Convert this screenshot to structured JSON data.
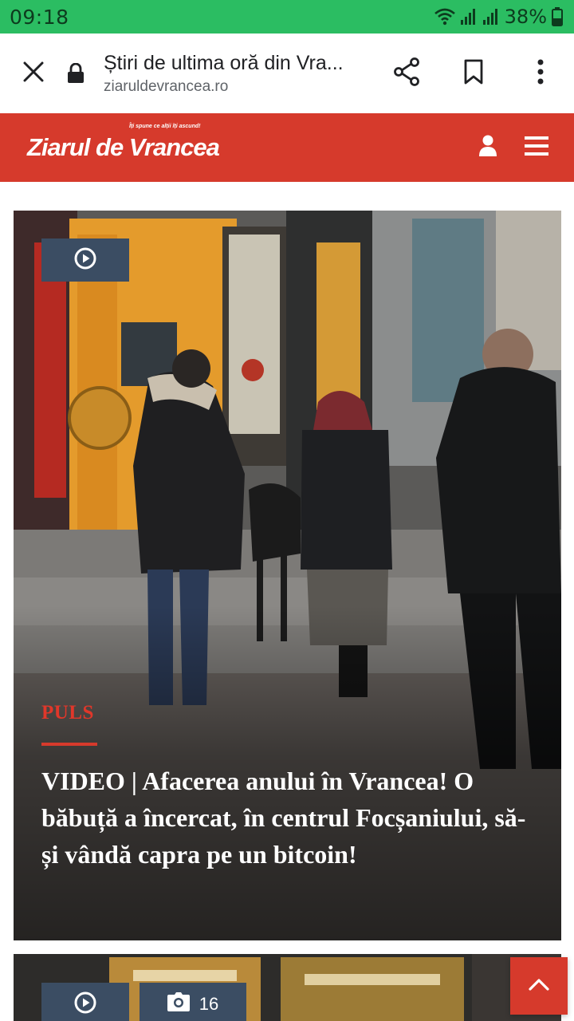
{
  "status_bar": {
    "time": "09:18",
    "battery": "38%",
    "icons": [
      "wifi-icon",
      "signal-icon",
      "signal-icon",
      "battery-icon"
    ]
  },
  "browser": {
    "page_title": "Știri de ultima oră din Vra...",
    "domain": "ziaruldevrancea.ro",
    "icons": [
      "close-icon",
      "lock-icon",
      "share-icon",
      "bookmark-icon",
      "more-vert-icon"
    ]
  },
  "site": {
    "logo": "Ziarul de Vrancea",
    "tagline": "Îți spune ce alții îți ascund!",
    "brand_color": "#d63a2c",
    "icons": [
      "user-icon",
      "menu-icon"
    ]
  },
  "articles": [
    {
      "category": "PULS",
      "headline": "VIDEO | Afacerea anului în Vrancea! O băbuță a încercat, în centrul Focșaniului, să-și vândă capra pe un bitcoin!",
      "badges": [
        "video-icon"
      ]
    },
    {
      "badges": [
        "video-icon",
        "camera-icon"
      ],
      "photo_count": "16"
    }
  ],
  "scroll_top": {
    "icon": "chevron-up-icon"
  }
}
